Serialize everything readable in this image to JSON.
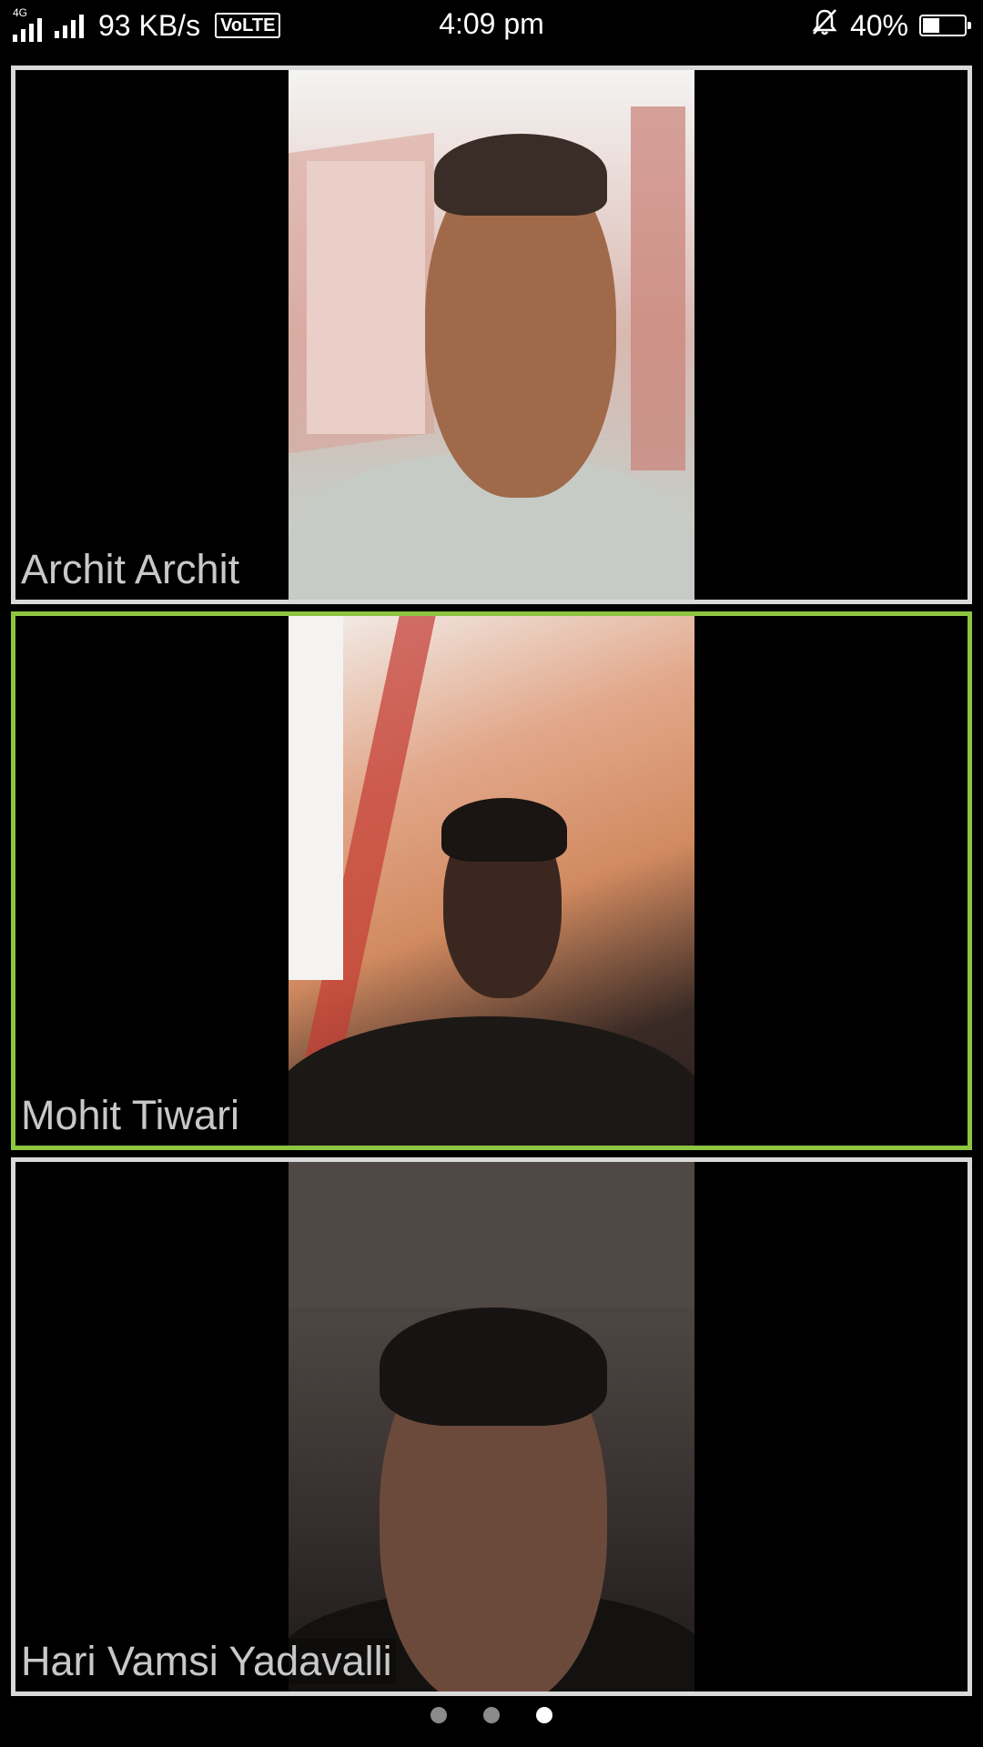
{
  "status_bar": {
    "network_type": "4G",
    "data_speed": "93 KB/s",
    "volte": "VoLTE",
    "time": "4:09 pm",
    "battery_percent": "40%",
    "battery_level": 0.4,
    "icons": [
      "signal-icon",
      "mute-bell-icon",
      "battery-icon"
    ]
  },
  "participants": [
    {
      "name": "Archit Archit",
      "active_speaker": false
    },
    {
      "name": "Mohit Tiwari",
      "active_speaker": true
    },
    {
      "name": "Hari Vamsi Yadavalli",
      "active_speaker": false
    }
  ],
  "pager": {
    "pages": 3,
    "current_page": 3
  },
  "colors": {
    "tile_border": "#d9d9d9",
    "active_border": "#8cc63f",
    "background": "#000000"
  }
}
